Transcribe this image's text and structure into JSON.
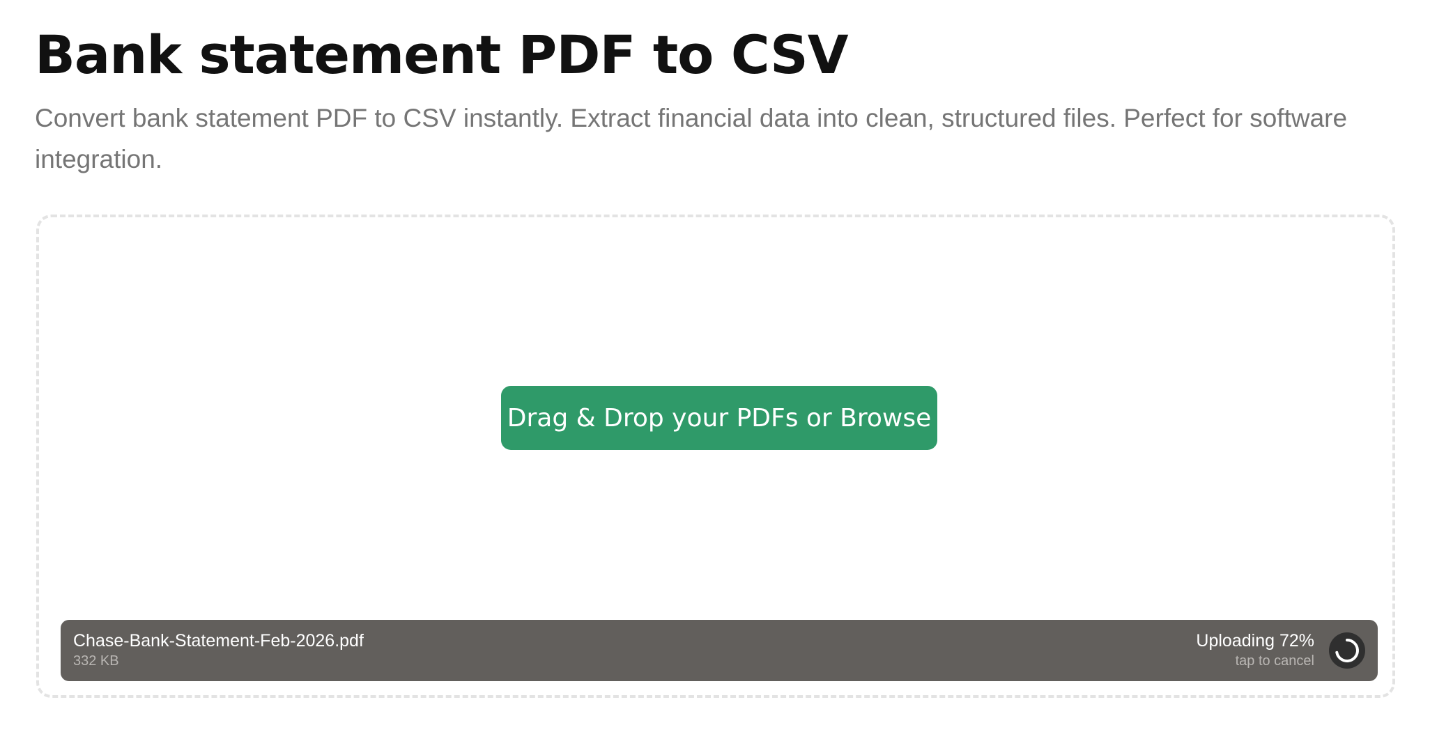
{
  "page": {
    "title": "Bank statement PDF to CSV",
    "subtitle": "Convert bank statement PDF to CSV instantly. Extract financial data into clean, structured files. Perfect for software integration."
  },
  "dropzone": {
    "button_label": "Drag & Drop your PDFs or Browse"
  },
  "upload": {
    "file_name": "Chase-Bank-Statement-Feb-2026.pdf",
    "file_size": "332 KB",
    "status": "Uploading 72%",
    "progress_percent": 72,
    "cancel_hint": "tap to cancel"
  },
  "icons": {
    "spinner": "loading-spinner-icon"
  },
  "colors": {
    "accent": "#2f9a69",
    "upload_bar": "#625f5c",
    "subtitle_text": "#757575",
    "dropzone_border": "#e3e3e3"
  }
}
